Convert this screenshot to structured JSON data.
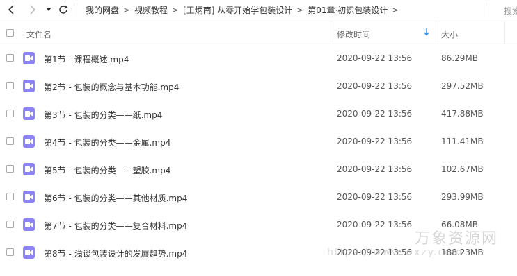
{
  "nav": {
    "breadcrumbs": [
      "我的网盘",
      "视频教程",
      "[王炳南] 从零开始学包装设计",
      "第01章·初识包装设计"
    ],
    "separator": ">",
    "search_label": "搜索"
  },
  "header": {
    "name": "文件名",
    "modified": "修改时间",
    "size": "大小",
    "sort_icon": "arrow-down-icon"
  },
  "files": [
    {
      "name": "第1节 - 课程概述.mp4",
      "modified": "2020-09-22 13:56",
      "size": "86.29MB"
    },
    {
      "name": "第2节 - 包装的概念与基本功能.mp4",
      "modified": "2020-09-22 13:56",
      "size": "297.52MB"
    },
    {
      "name": "第3节 - 包装的分类——纸.mp4",
      "modified": "2020-09-22 13:56",
      "size": "417.88MB"
    },
    {
      "name": "第4节 - 包装的分类——金属.mp4",
      "modified": "2020-09-22 13:56",
      "size": "111.41MB"
    },
    {
      "name": "第5节 - 包装的分类——塑胶.mp4",
      "modified": "2020-09-22 13:56",
      "size": "102.67MB"
    },
    {
      "name": "第6节 - 包装的分类——其他材质.mp4",
      "modified": "2020-09-22 13:56",
      "size": "293.99MB"
    },
    {
      "name": "第7节 - 包装的分类——复合材料.mp4",
      "modified": "2020-09-22 13:56",
      "size": "66.08MB"
    },
    {
      "name": "第8节 - 浅谈包装设计的发展趋势.mp4",
      "modified": "2020-09-22 13:56",
      "size": "188.23MB"
    }
  ],
  "watermark": {
    "title": "万象资源网",
    "url": "https://www.wxzy.com"
  },
  "colors": {
    "video_icon": "#8d83f5",
    "sort_accent": "#2b8bf2"
  }
}
